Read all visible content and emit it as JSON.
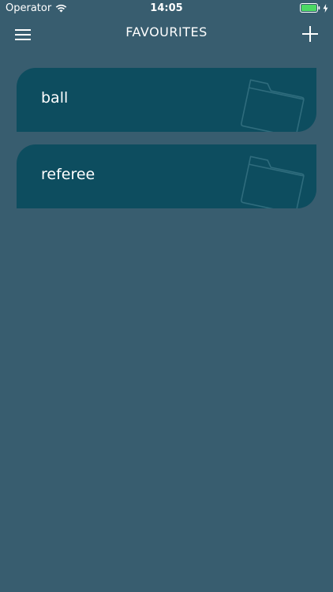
{
  "status_bar": {
    "carrier": "Operator",
    "time": "14:05",
    "icons": [
      "wifi-icon",
      "battery-icon",
      "charging-bolt-icon"
    ],
    "battery_color": "#4cd964"
  },
  "nav": {
    "title": "FAVOURITES",
    "left_icon": "hamburger-menu-icon",
    "right_icon": "plus-icon"
  },
  "folders": [
    {
      "label": "ball",
      "icon": "folder-icon"
    },
    {
      "label": "referee",
      "icon": "folder-icon"
    }
  ],
  "colors": {
    "background": "#385d6f",
    "card": "#0d4d5f",
    "text": "#ffffff"
  }
}
